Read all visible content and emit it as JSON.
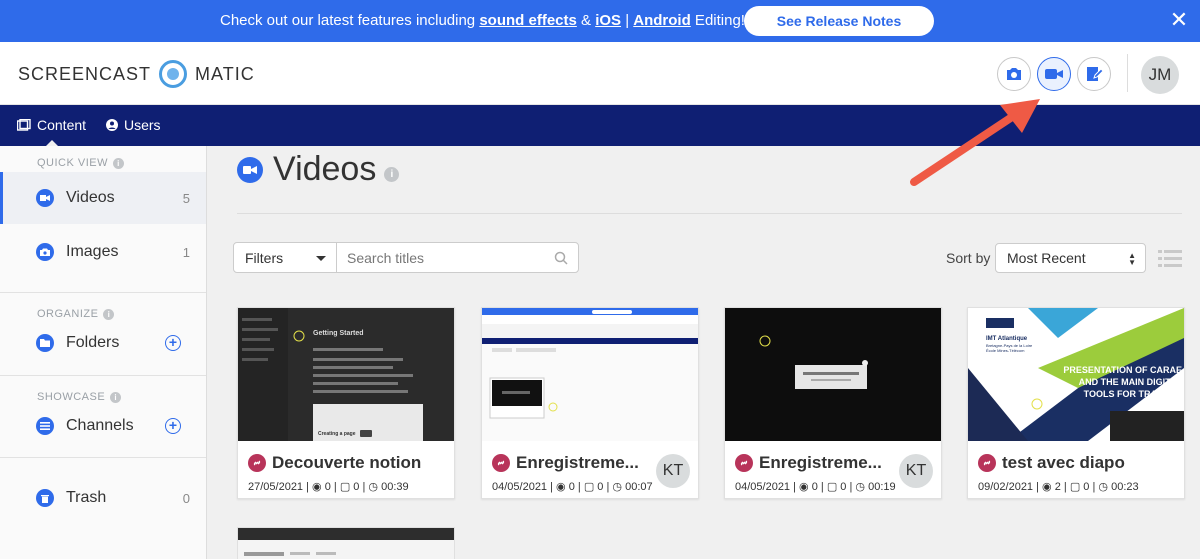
{
  "banner": {
    "prefix": "Check out our latest features including ",
    "link_sound": "sound effects",
    "amp": " & ",
    "link_ios": "iOS",
    "pipe": " | ",
    "link_android": "Android",
    "suffix": " Editing!",
    "button_label": "See Release Notes",
    "close_label": "✕"
  },
  "header": {
    "logo_left": "SCREENCAST",
    "logo_right": "MATIC",
    "avatar_initials": "JM"
  },
  "nav": {
    "content_label": "Content",
    "users_label": "Users"
  },
  "sidebar": {
    "quick_view_heading": "QUICK VIEW",
    "organize_heading": "ORGANIZE",
    "showcase_heading": "SHOWCASE",
    "items": [
      {
        "label": "Videos",
        "count": "5"
      },
      {
        "label": "Images",
        "count": "1"
      },
      {
        "label": "Folders",
        "count": ""
      },
      {
        "label": "Channels",
        "count": ""
      },
      {
        "label": "Trash",
        "count": "0"
      }
    ],
    "add_symbol": "+",
    "info_symbol": "i"
  },
  "main": {
    "title": "Videos",
    "info_symbol": "i",
    "filters_label": "Filters",
    "search_placeholder": "Search titles",
    "sort_label": "Sort by",
    "sort_value": "Most Recent"
  },
  "cards": [
    {
      "title": "Decouverte notion",
      "date": "27/05/2021",
      "views": "0",
      "comments": "0",
      "duration": "00:39",
      "owner": ""
    },
    {
      "title": "Enregistreme...",
      "date": "04/05/2021",
      "views": "0",
      "comments": "0",
      "duration": "00:07",
      "owner": "KT"
    },
    {
      "title": "Enregistreme...",
      "date": "04/05/2021",
      "views": "0",
      "comments": "0",
      "duration": "00:19",
      "owner": "KT"
    },
    {
      "title": "test avec diapo",
      "date": "09/02/2021",
      "views": "2",
      "comments": "0",
      "duration": "00:23",
      "owner": ""
    }
  ],
  "thumbs": {
    "notion_heading": "Getting Started",
    "notion_sub": "Creating a page",
    "imt_logo": "IMT Atlantique",
    "imt_sub1": "Bretagne-Pays de la Loire",
    "imt_sub2": "École Mines-Télécom",
    "slide_text": "PRESENTATION OF CARAE AND THE MAIN DIGITAL TOOLS FOR TRAINING"
  },
  "colors": {
    "banner_blue": "#2f6bea",
    "nav_navy": "#0f1f73",
    "accent": "#2f6bea",
    "link_badge": "#b8345a",
    "arrow": "#ef5a45"
  }
}
